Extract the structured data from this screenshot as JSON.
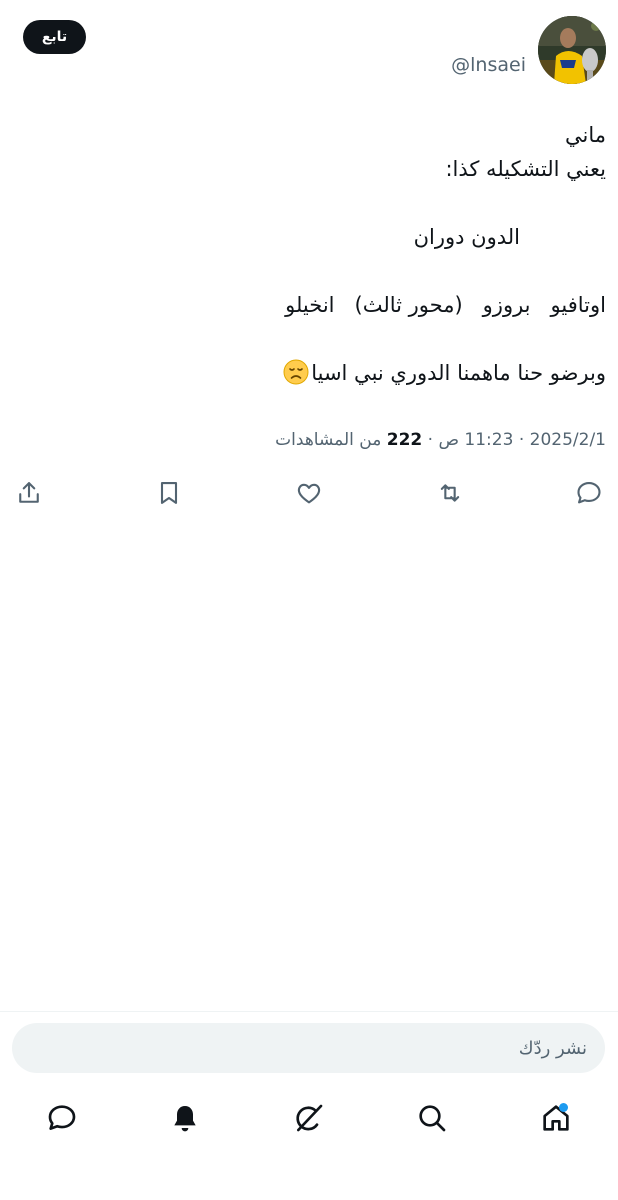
{
  "header": {
    "follow_label": "تابع",
    "handle": "@lnsaei"
  },
  "tweet": {
    "lines": [
      "ماني",
      "يعني التشكيله كذا:",
      "",
      "الدون دوران",
      "",
      "اوتافيو   بروزو   (محور ثالث)   انخيلو",
      "",
      "وبرضو حنا ماهمنا الدوري نبي اسيا"
    ],
    "emoji": "disappointed-face"
  },
  "meta": {
    "date": "2025/2/1",
    "time": "11:23 ص",
    "views_count": "222",
    "views_label": "من المشاهدات",
    "separator": "·"
  },
  "reply": {
    "placeholder": "نشر ردّك"
  },
  "actions": [
    "reply-icon",
    "retweet-icon",
    "like-icon",
    "bookmark-icon",
    "share-icon"
  ],
  "nav": [
    "home-icon",
    "search-icon",
    "grok-icon",
    "notifications-icon",
    "messages-icon"
  ],
  "colors": {
    "text": "#0f1419",
    "secondary": "#536471",
    "accent": "#1d9bf0",
    "follow_bg": "#0f1419",
    "reply_bg": "#eff3f4"
  }
}
